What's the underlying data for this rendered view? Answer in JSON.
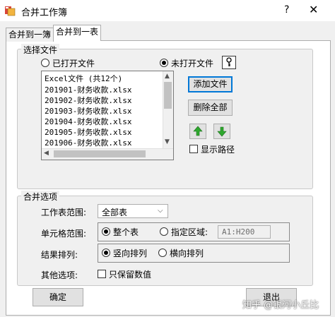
{
  "window": {
    "title": "合并工作簿",
    "help": "?",
    "close": "✕"
  },
  "tabs": [
    {
      "label": "合并到一簿"
    },
    {
      "label": "合并到一表"
    }
  ],
  "select_files": {
    "legend": "选择文件",
    "radio_opened": "已打开文件",
    "radio_unopened": "未打开文件",
    "list_header": "Excel文件 (共12个)",
    "files": [
      "201901-财务收款.xlsx",
      "201902-财务收款.xlsx",
      "201903-财务收款.xlsx",
      "201904-财务收款.xlsx",
      "201905-财务收款.xlsx",
      "201906-财务收款.xlsx"
    ],
    "add_button": "添加文件",
    "delete_all_button": "删除全部",
    "show_path_label": "显示路径"
  },
  "merge_options": {
    "legend": "合并选项",
    "sheet_range_label": "工作表范围:",
    "sheet_range_value": "全部表",
    "cell_range_label": "单元格范围:",
    "cell_whole_table": "整个表",
    "cell_specified": "指定区域:",
    "cell_range_value": "A1:H200",
    "result_sort_label": "结果排列:",
    "sort_vertical": "竖向排列",
    "sort_horizontal": "横向排列",
    "other_label": "其他选项:",
    "values_only_label": "只保留数值"
  },
  "footer": {
    "ok_button": "确定",
    "exit_button": "退出",
    "watermark": "知乎 @银河小丘比"
  },
  "colors": {
    "focus": "#0078d7",
    "up_arrow": "#2ea82e"
  }
}
